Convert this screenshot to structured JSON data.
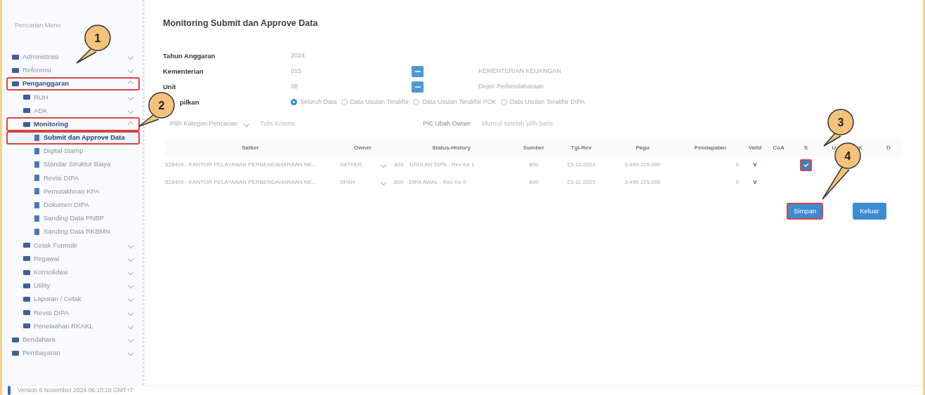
{
  "sidebar": {
    "search_placeholder": "Pencarian Menu",
    "items": [
      {
        "label": "Administrasi",
        "expanded": false,
        "highlighted": false,
        "selected": false
      },
      {
        "label": "Referensi",
        "expanded": false,
        "highlighted": false,
        "selected": false
      },
      {
        "label": "Penganggaran",
        "expanded": true,
        "highlighted": true,
        "selected": false,
        "children": [
          {
            "label": "RUH",
            "expanded": false,
            "highlighted": false,
            "selected": false
          },
          {
            "label": "ADK",
            "expanded": false,
            "highlighted": false,
            "selected": false
          },
          {
            "label": "Monitoring",
            "expanded": true,
            "highlighted": true,
            "selected": false,
            "children": [
              {
                "label": "Submit dan Approve Data",
                "highlighted": true,
                "selected": true
              },
              {
                "label": "Digital Stamp",
                "highlighted": false,
                "selected": false
              },
              {
                "label": "Standar Struktur Biaya",
                "highlighted": false,
                "selected": false
              },
              {
                "label": "Revisi DIPA",
                "highlighted": false,
                "selected": false
              },
              {
                "label": "Pemutakhiran KPA",
                "highlighted": false,
                "selected": false
              },
              {
                "label": "Dokumen DIPA",
                "highlighted": false,
                "selected": false
              },
              {
                "label": "Sanding Data PNBP",
                "highlighted": false,
                "selected": false
              },
              {
                "label": "Sanding Data RKBMN",
                "highlighted": false,
                "selected": false
              }
            ]
          },
          {
            "label": "Cetak Formulir",
            "expanded": false,
            "highlighted": false,
            "selected": false
          },
          {
            "label": "Pegawai",
            "expanded": false,
            "highlighted": false,
            "selected": false
          },
          {
            "label": "Konsolidasi",
            "expanded": false,
            "highlighted": false,
            "selected": false
          },
          {
            "label": "Utility",
            "expanded": false,
            "highlighted": false,
            "selected": false
          },
          {
            "label": "Laporan / Cetak",
            "expanded": false,
            "highlighted": false,
            "selected": false
          },
          {
            "label": "Revisi DIPA",
            "expanded": false,
            "highlighted": false,
            "selected": false
          },
          {
            "label": "Penelaahan RKAKL",
            "expanded": false,
            "highlighted": false,
            "selected": false
          }
        ]
      },
      {
        "label": "Bendahara",
        "expanded": false,
        "highlighted": false,
        "selected": false
      },
      {
        "label": "Pembayaran",
        "expanded": false,
        "highlighted": false,
        "selected": false
      }
    ]
  },
  "page_title": "Monitoring Submit dan Approve Data",
  "form": [
    {
      "kind": "text",
      "label": "Tahun Anggaran",
      "value": "2024"
    },
    {
      "kind": "lookup",
      "label": "Kementerian",
      "value": "015",
      "name": "KEMENTERIAN KEUANGAN"
    },
    {
      "kind": "lookup",
      "label": "Unit",
      "value": "08",
      "name": "Dirjen Perbendaharaan"
    },
    {
      "kind": "radios",
      "label": "pilkan",
      "options": [
        {
          "label": "Seluruh Data",
          "selected": true
        },
        {
          "label": "Data Usulan Terakhir",
          "selected": false
        },
        {
          "label": "Data Usulan Terakhir POK",
          "selected": false
        },
        {
          "label": "Data Usulan Terakhir DIPA",
          "selected": false
        }
      ]
    }
  ],
  "filter": {
    "category": "Pilih Kategori Pencarian",
    "criteria_placeholder": "Tulis Kriteria",
    "owner_label": "PIC Ubah Owner",
    "owner_placeholder": "Muncul setelah pilih baris"
  },
  "table": {
    "columns": [
      "Satker",
      "Owner",
      "Status-History",
      "Sumber",
      "Tgl-Rev",
      "Pagu",
      "Pendapatan",
      "Valid",
      "CoA",
      "S",
      "U",
      "K",
      "D"
    ],
    "rows": [
      {
        "satker": "528409 - KANTOR PELAYANAN PERBENDAHARAAN NE...",
        "owner": "SATKER",
        "status_code": "A01",
        "status": "USULAN DIPA - Rev Ke 1",
        "sumber": "800",
        "tgl_rev": "23-11-2023",
        "pagu": "3.499.225.000",
        "pendapatan": "0",
        "valid": "V",
        "approve_box": {
          "checked": true,
          "highlighted": true
        }
      },
      {
        "satker": "528409 - KANTOR PELAYANAN PERBENDAHARAAN NE...",
        "owner": "SPAN",
        "status_code": "800",
        "status": "DIPA AWAL - Rev Ke 0",
        "sumber": "800",
        "tgl_rev": "23-11-2023",
        "pagu": "3.499.225.000",
        "pendapatan": "0",
        "valid": "V"
      }
    ]
  },
  "buttons": [
    {
      "label": "Simpan",
      "highlighted": true
    },
    {
      "label": "Keluar",
      "highlighted": false
    }
  ],
  "footer": "Version 6 November 2024 06:10:18 GMT+7",
  "callouts": [
    "1",
    "2",
    "3",
    "4"
  ]
}
